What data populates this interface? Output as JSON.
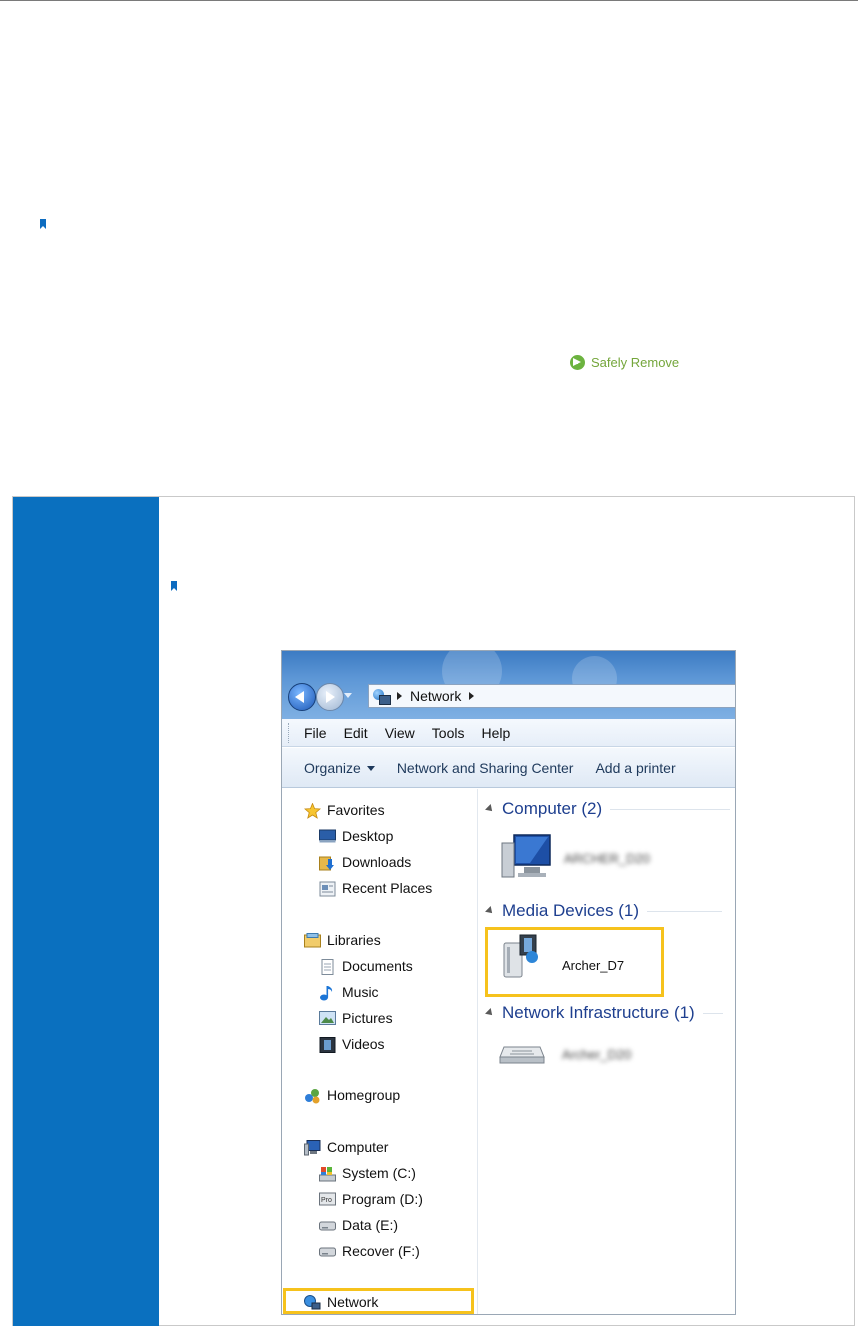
{
  "doc": {
    "safely_remove_label": "Safely Remove"
  },
  "explorer": {
    "address": {
      "crumb": "Network"
    },
    "menu": [
      "File",
      "Edit",
      "View",
      "Tools",
      "Help"
    ],
    "commands": {
      "organize": "Organize",
      "network_sharing": "Network and Sharing Center",
      "add_printer": "Add a printer"
    },
    "nav": {
      "favorites": "Favorites",
      "desktop": "Desktop",
      "downloads": "Downloads",
      "recent_places": "Recent Places",
      "libraries": "Libraries",
      "documents": "Documents",
      "music": "Music",
      "pictures": "Pictures",
      "videos": "Videos",
      "homegroup": "Homegroup",
      "computer": "Computer",
      "system": "System (C:)",
      "program": "Program (D:)",
      "data": "Data (E:)",
      "recover": "Recover (F:)",
      "network": "Network"
    },
    "groups": {
      "computer": "Computer (2)",
      "media": "Media Devices (1)",
      "infrastructure": "Network Infrastructure (1)"
    },
    "devices": {
      "computer_name": "ARCHER_D20",
      "media_name": "Archer_D7",
      "router_name": "Archer_D20"
    }
  },
  "colors": {
    "accent_blue": "#0a70bf",
    "highlight": "#f6c21c",
    "safely_green": "#74a63b"
  }
}
